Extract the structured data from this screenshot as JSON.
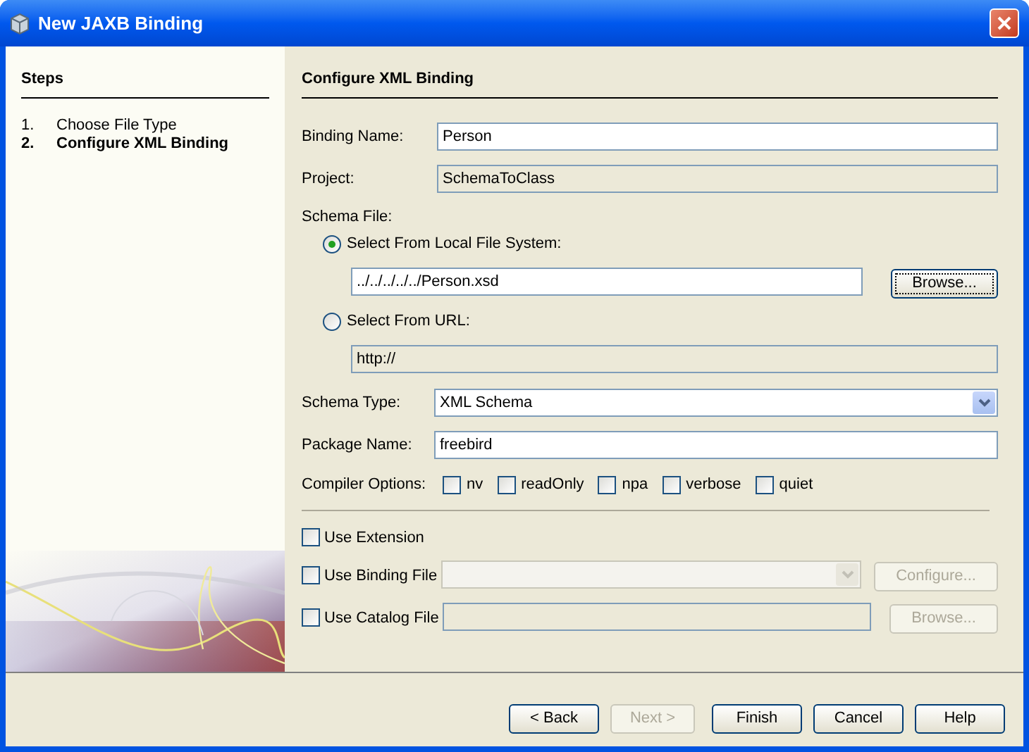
{
  "window": {
    "title": "New JAXB Binding"
  },
  "steps": {
    "title": "Steps",
    "items": [
      {
        "number": "1.",
        "label": "Choose File Type",
        "selected": false
      },
      {
        "number": "2.",
        "label": "Configure XML Binding",
        "selected": true
      }
    ]
  },
  "panel": {
    "title": "Configure XML Binding"
  },
  "binding_name": {
    "label": "Binding Name:",
    "value": "Person",
    "disabled": false
  },
  "project": {
    "label": "Project:",
    "value": "SchemaToClass",
    "disabled": true
  },
  "schema_file": {
    "label": "Schema File:",
    "sources": [
      {
        "label": "Select From Local File System:",
        "selected": true,
        "value": "../../../../../Person.xsd",
        "disabled": false,
        "button": {
          "label": "Browse...",
          "focused": true
        }
      },
      {
        "label": "Select From URL:",
        "selected": false,
        "value": "http://",
        "disabled": true
      }
    ]
  },
  "schema_type": {
    "label": "Schema Type:",
    "value": "XML Schema"
  },
  "package_name": {
    "label": "Package Name:",
    "value": "freebird",
    "disabled": false
  },
  "compiler_options": {
    "label": "Compiler Options:",
    "options": [
      {
        "label": "nv",
        "checked": false
      },
      {
        "label": "readOnly",
        "checked": false
      },
      {
        "label": "npa",
        "checked": false
      },
      {
        "label": "verbose",
        "checked": false
      },
      {
        "label": "quiet",
        "checked": false
      }
    ]
  },
  "extras": [
    {
      "kind": "plain",
      "label": "Use Extension",
      "checked": false
    },
    {
      "kind": "combo",
      "label": "Use Binding File",
      "checked": false,
      "button": {
        "label": "Configure..."
      }
    },
    {
      "kind": "field",
      "label": "Use Catalog File",
      "checked": false,
      "button": {
        "label": "Browse..."
      }
    }
  ],
  "buttons": [
    {
      "label": "< Back",
      "disabled": false
    },
    {
      "label": "Next >",
      "disabled": true
    },
    {
      "label": "Finish",
      "disabled": false
    },
    {
      "label": "Cancel",
      "disabled": false
    },
    {
      "label": "Help",
      "disabled": false
    }
  ]
}
